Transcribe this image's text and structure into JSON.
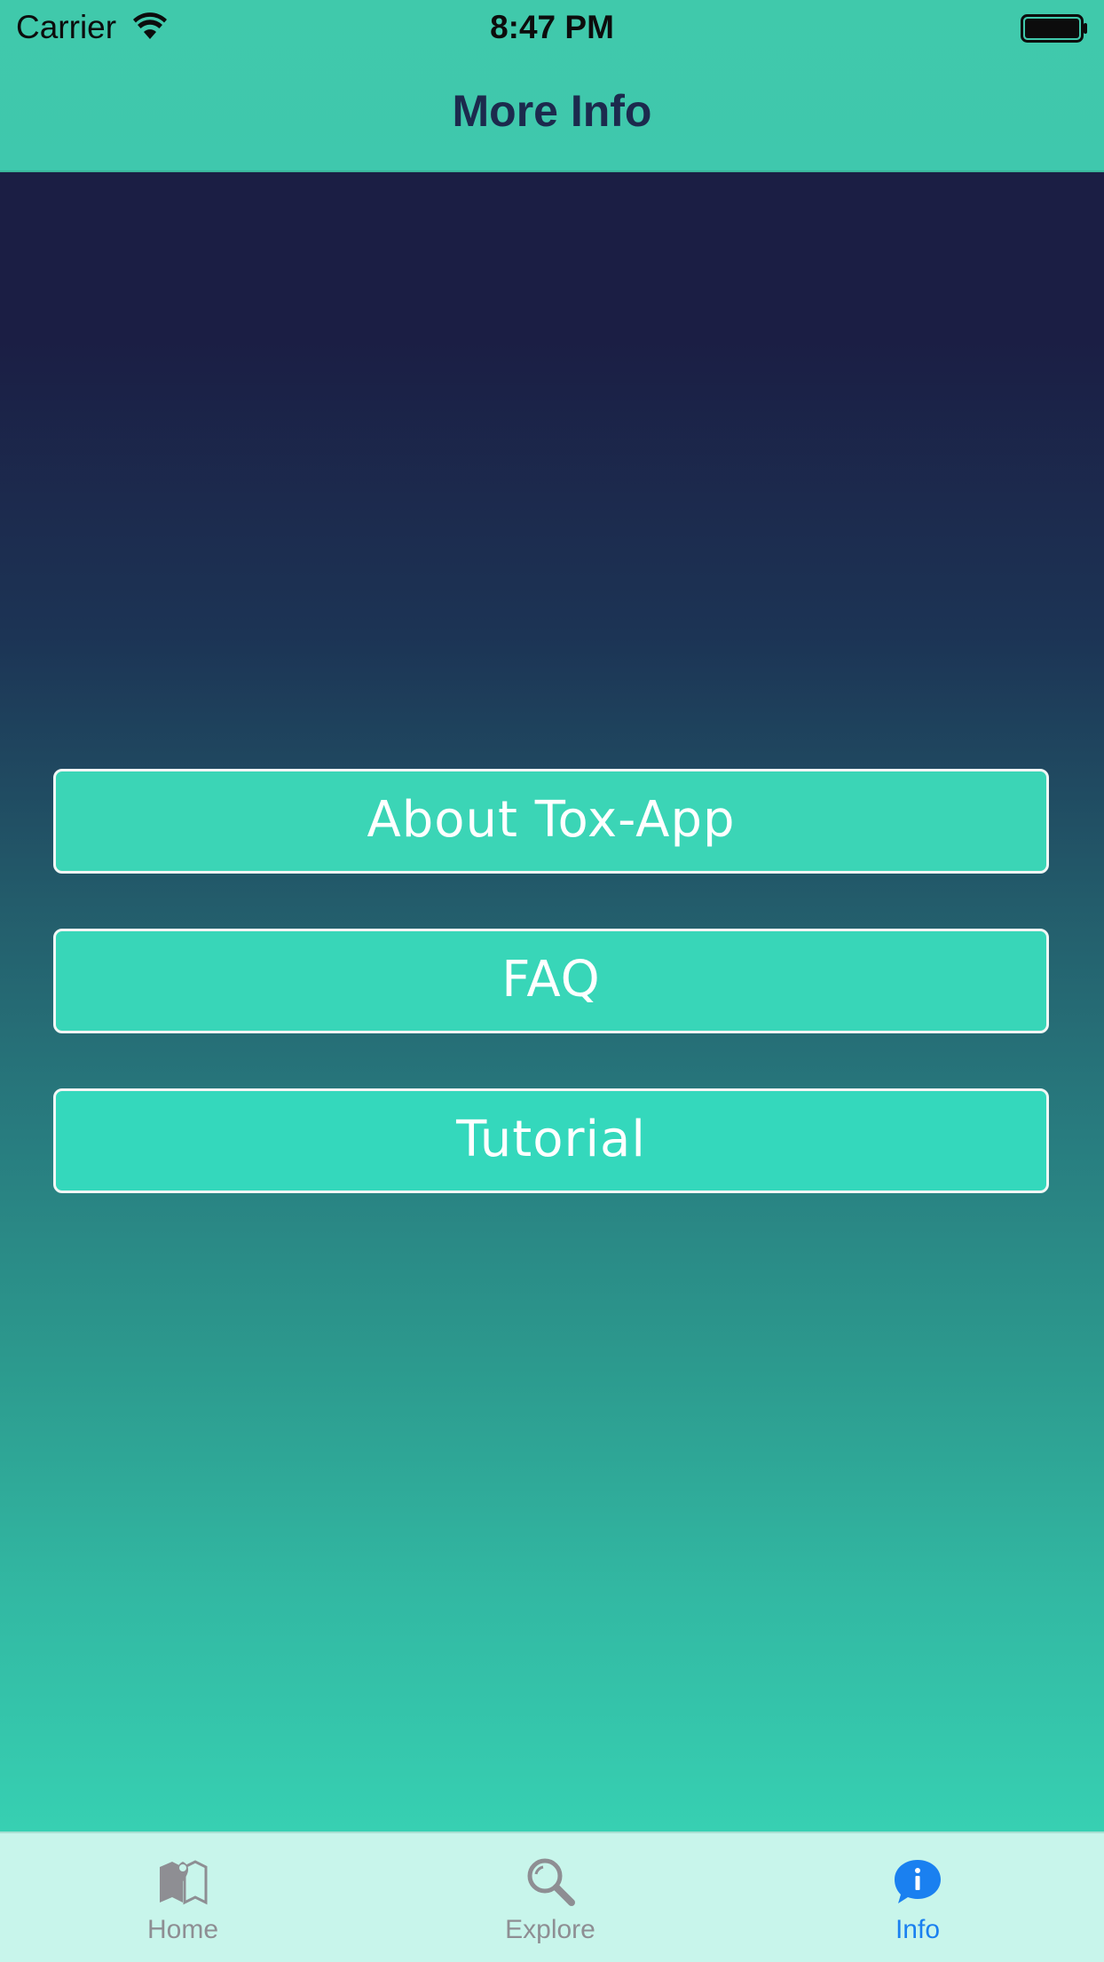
{
  "status_bar": {
    "carrier": "Carrier",
    "time": "8:47 PM",
    "wifi_icon": "wifi-icon",
    "battery_icon": "battery-icon"
  },
  "nav": {
    "title": "More Info"
  },
  "buttons": [
    {
      "label": "About Tox-App"
    },
    {
      "label": "FAQ"
    },
    {
      "label": "Tutorial"
    }
  ],
  "tabbar": {
    "items": [
      {
        "label": "Home",
        "icon": "map-pin-icon",
        "selected": false
      },
      {
        "label": "Explore",
        "icon": "search-icon",
        "selected": false
      },
      {
        "label": "Info",
        "icon": "info-bubble-icon",
        "selected": true
      }
    ]
  },
  "colors": {
    "accent": "#3bd6b6",
    "nav_bar": "#40c9ab",
    "gradient_top": "#1b1e44",
    "gradient_bottom": "#37d0b2",
    "nav_title": "#1c2a4d",
    "tab_selected": "#1a80f0",
    "tab_unselected": "#8e8e93",
    "tabbar_bg": "#c8f5eb"
  }
}
